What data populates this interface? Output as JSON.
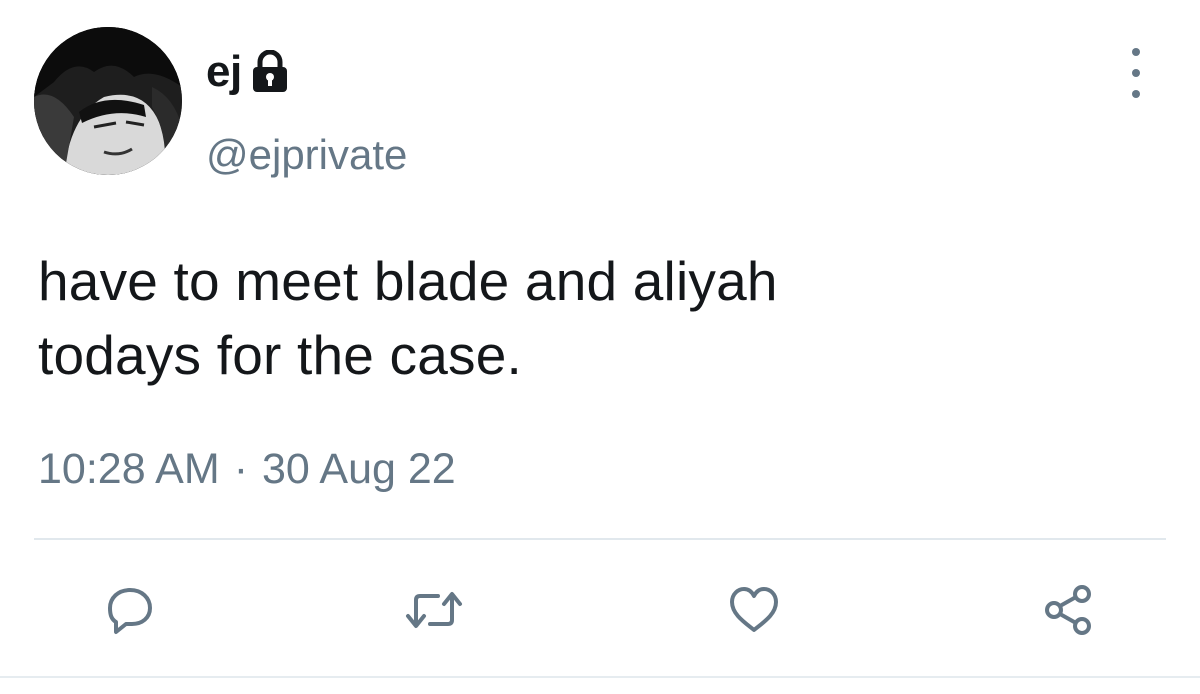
{
  "tweet": {
    "display_name": "ej",
    "protected_icon": "lock-icon",
    "handle": "@ejprivate",
    "text_line1": "have to meet blade and aliyah",
    "text_line2": "todays for the case.",
    "time": "10:28 AM",
    "separator": "·",
    "date": "30 Aug 22"
  },
  "actions": [
    {
      "icon": "reply-icon"
    },
    {
      "icon": "retweet-icon"
    },
    {
      "icon": "like-icon"
    },
    {
      "icon": "share-icon"
    }
  ],
  "colors": {
    "text": "#14171a",
    "secondary": "#657786",
    "divider": "#e1e8ed"
  }
}
